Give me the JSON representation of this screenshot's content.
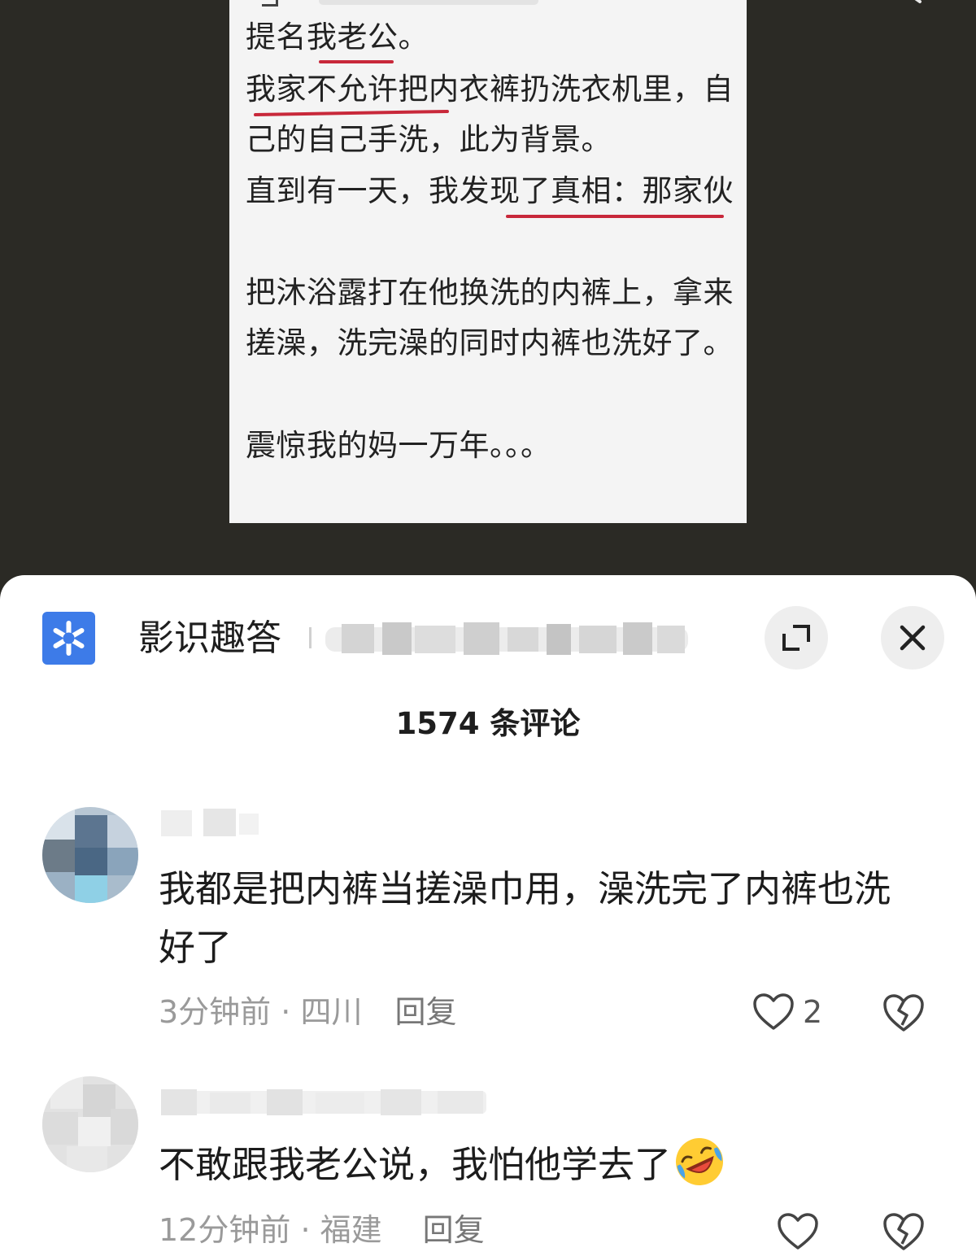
{
  "post": {
    "lines": [
      "提名我老公。",
      "我家不允许把内衣裤扔洗衣机里，自",
      "己的自己手洗，此为背景。",
      "直到有一天，我发现了真相：那家伙",
      "把沐浴露打在他换洗的内裤上，拿来",
      "搓澡，洗完澡的同时内裤也洗好了。",
      "震惊我的妈一万年。。。"
    ]
  },
  "header": {
    "app_name": "影识趣答",
    "logo_icon": "asterisk-icon",
    "logo_color": "#3d7be8"
  },
  "comments_header": {
    "count_label": "1574 条评论"
  },
  "comments": [
    {
      "text": "我都是把内裤当搓澡巾用，澡洗完了内裤也洗好了",
      "time": "3分钟前",
      "location": "四川",
      "reply": "回复",
      "likes": "2"
    },
    {
      "text": "不敢跟我老公说，我怕他学去了",
      "emoji": "rolling-laughing-emoji",
      "time": "12分钟前",
      "location": "福建",
      "reply": "回复",
      "likes": ""
    }
  ],
  "meta_separator": " · "
}
